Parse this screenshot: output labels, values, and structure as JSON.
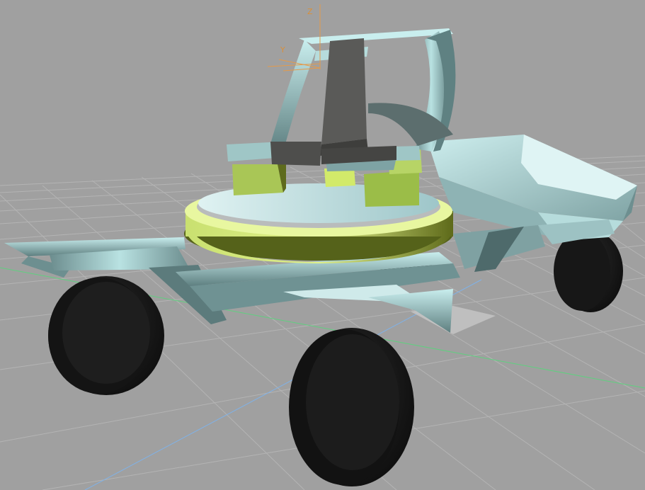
{
  "viewport": {
    "name": "3d-perspective-viewport",
    "background": "#a0a0a0",
    "grid_color": "#b2b2b2",
    "world_x_axis_color": "#5fd07f",
    "world_y_axis_color": "#7fb2e8"
  },
  "gizmo": {
    "color": "#e49a4a",
    "z_label": "Z",
    "y_label": "Y"
  },
  "model": {
    "description_icon": "lunar-rover-model",
    "frame_color": "#a9dcdc",
    "wheel_color": "#1b1b1b",
    "turret_color": "#b9d85a",
    "deck_color": "#cfe8ec",
    "seat_color": "#545452"
  }
}
